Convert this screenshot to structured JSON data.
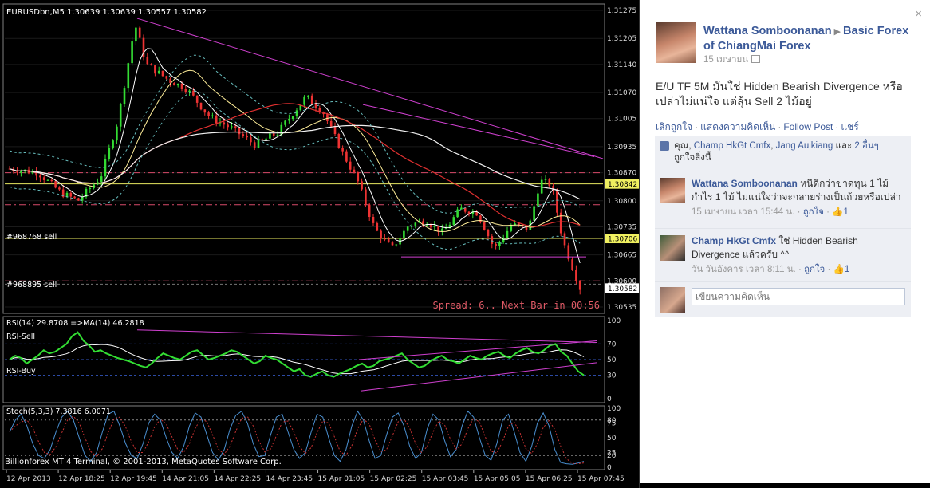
{
  "chart": {
    "header": "EURUSDbn,M5  1.30639 1.30639 1.30557 1.30582",
    "price_ticks": [
      "1.31275",
      "1.31205",
      "1.31140",
      "1.31070",
      "1.31005",
      "1.30935",
      "1.30870",
      "1.30800",
      "1.30735",
      "1.30665",
      "1.30600",
      "1.30535"
    ],
    "price_tick_values": [
      1.31275,
      1.31205,
      1.3114,
      1.3107,
      1.31005,
      1.30935,
      1.3087,
      1.308,
      1.30735,
      1.30665,
      1.306,
      1.30535
    ],
    "price_range": [
      1.30525,
      1.31285
    ],
    "level_yellow_1": {
      "label": "1.30842",
      "value": 1.30842
    },
    "level_yellow_2": {
      "label": "1.30706",
      "value": 1.30706
    },
    "last_price": {
      "label": "1.30582",
      "value": 1.30582
    },
    "order_sell_1": "#968768 sell",
    "order_sell_2": "#968895 sell",
    "spread_text": "Spread: 6.. Next Bar in 00:56",
    "rsi": {
      "header": "RSI(14) 29.8708  =>MA(14) 46.2818",
      "label_sell": "RSI-Sell",
      "label_buy": "RSI-Buy",
      "ticks": [
        "100",
        "70",
        "50",
        "30",
        "0"
      ],
      "tick_values": [
        100,
        70,
        50,
        30,
        0
      ],
      "series": [
        50,
        55,
        52,
        45,
        50,
        55,
        62,
        58,
        60,
        65,
        70,
        80,
        85,
        74,
        68,
        60,
        62,
        58,
        55,
        52,
        50,
        48,
        45,
        42,
        40,
        45,
        52,
        58,
        55,
        52,
        50,
        55,
        60,
        62,
        56,
        50,
        52,
        55,
        58,
        62,
        60,
        55,
        50,
        45,
        48,
        55,
        52,
        50,
        45,
        40,
        35,
        38,
        30,
        28,
        32,
        35,
        30,
        28,
        32,
        35,
        38,
        42,
        45,
        40,
        42,
        48,
        50,
        52,
        55,
        58,
        50,
        45,
        40,
        42,
        48,
        52,
        55,
        50,
        48,
        45,
        50,
        55,
        52,
        50,
        55,
        58,
        60,
        55,
        52,
        58,
        62,
        65,
        60,
        58,
        62,
        68,
        70,
        60,
        55,
        45,
        35,
        30
      ]
    },
    "stoch": {
      "header": "Stoch(5,3,3) 7.3816 6.0071",
      "ticks": [
        "100",
        "80",
        "75",
        "50",
        "25",
        "20",
        "0"
      ],
      "tick_values": [
        100,
        80,
        75,
        50,
        25,
        20,
        0
      ],
      "series": [
        60,
        80,
        90,
        70,
        40,
        20,
        15,
        30,
        60,
        85,
        95,
        80,
        50,
        20,
        10,
        25,
        60,
        90,
        95,
        70,
        40,
        20,
        15,
        40,
        75,
        90,
        80,
        50,
        25,
        15,
        35,
        70,
        92,
        85,
        55,
        25,
        12,
        30,
        65,
        88,
        95,
        75,
        40,
        18,
        20,
        55,
        85,
        90,
        60,
        30,
        15,
        25,
        60,
        90,
        85,
        50,
        20,
        10,
        30,
        70,
        95,
        80,
        45,
        15,
        20,
        55,
        85,
        92,
        70,
        35,
        15,
        25,
        65,
        90,
        80,
        45,
        18,
        30,
        70,
        95,
        85,
        50,
        20,
        12,
        40,
        80,
        90,
        60,
        25,
        10,
        35,
        75,
        92,
        70,
        30,
        8,
        6,
        5,
        7,
        10
      ]
    },
    "time_labels": [
      "12 Apr 2013",
      "12 Apr 18:25",
      "12 Apr 19:45",
      "14 Apr 21:05",
      "14 Apr 22:25",
      "14 Apr 23:45",
      "15 Apr 01:05",
      "15 Apr 02:25",
      "15 Apr 03:45",
      "15 Apr 05:05",
      "15 Apr 06:25",
      "15 Apr 07:45"
    ],
    "copyright": "Billionforex MT 4 Terminal, © 2001-2013, MetaQuotes Software Corp."
  },
  "chart_data": [
    {
      "type": "line",
      "title": "EURUSDbn,M5",
      "ylim": [
        1.30535,
        1.31275
      ],
      "x": [
        "12 Apr 2013",
        "12 Apr 18:25",
        "12 Apr 19:45",
        "14 Apr 21:05",
        "14 Apr 22:25",
        "14 Apr 23:45",
        "15 Apr 01:05",
        "15 Apr 02:25",
        "15 Apr 03:45",
        "15 Apr 05:05",
        "15 Apr 06:25",
        "15 Apr 07:45"
      ],
      "series": [
        {
          "values": [
            1.3088,
            1.3083,
            1.3118,
            1.3103,
            1.3098,
            1.31,
            1.3102,
            1.3075,
            1.3072,
            1.307,
            1.308,
            1.30582
          ]
        }
      ]
    }
  ],
  "post": {
    "poster_name": "Wattana Somboonanan",
    "page_name": "Basic Forex of ChiangMai Forex",
    "date": "15 เมษายน",
    "caption": "E/U TF 5M มันใช่ Hidden Bearish Divergence หรือเปล่าไม่แน่ใจ แต่ลุ้น Sell 2 ไม้อยู่",
    "actions": [
      "เลิกถูกใจ",
      "แสดงความคิดเห็น",
      "Follow Post",
      "แชร์"
    ],
    "likes": {
      "you": "คุณ",
      "u1": "Champ HkGt Cmfx",
      "u2": "Jang Auikiang",
      "and": "และ",
      "more": "2 อื่นๆ",
      "tail": "ถูกใจสิ่งนี้"
    },
    "comments": [
      {
        "author": "Wattana Somboonanan",
        "text": "หนีดีกว่าขาดทุน 1 ไม้ กำไร 1 ไม้ ไม่แน่ใจว่าจะกลายร่างเป็นถ้วยหรือเปล่า",
        "time": "15 เมษายน เวลา 15:44 น.",
        "like": "ถูกใจ",
        "count": "1"
      },
      {
        "author": "Champ HkGt Cmfx",
        "text": "ใช่ Hidden Bearish Divergence แล้วครับ ^^",
        "time": "วัน วันอังคาร เวลา 8:11 น.",
        "like": "ถูกใจ",
        "count": "1"
      }
    ],
    "comment_placeholder": "เขียนความคิดเห็น",
    "close": "×"
  }
}
